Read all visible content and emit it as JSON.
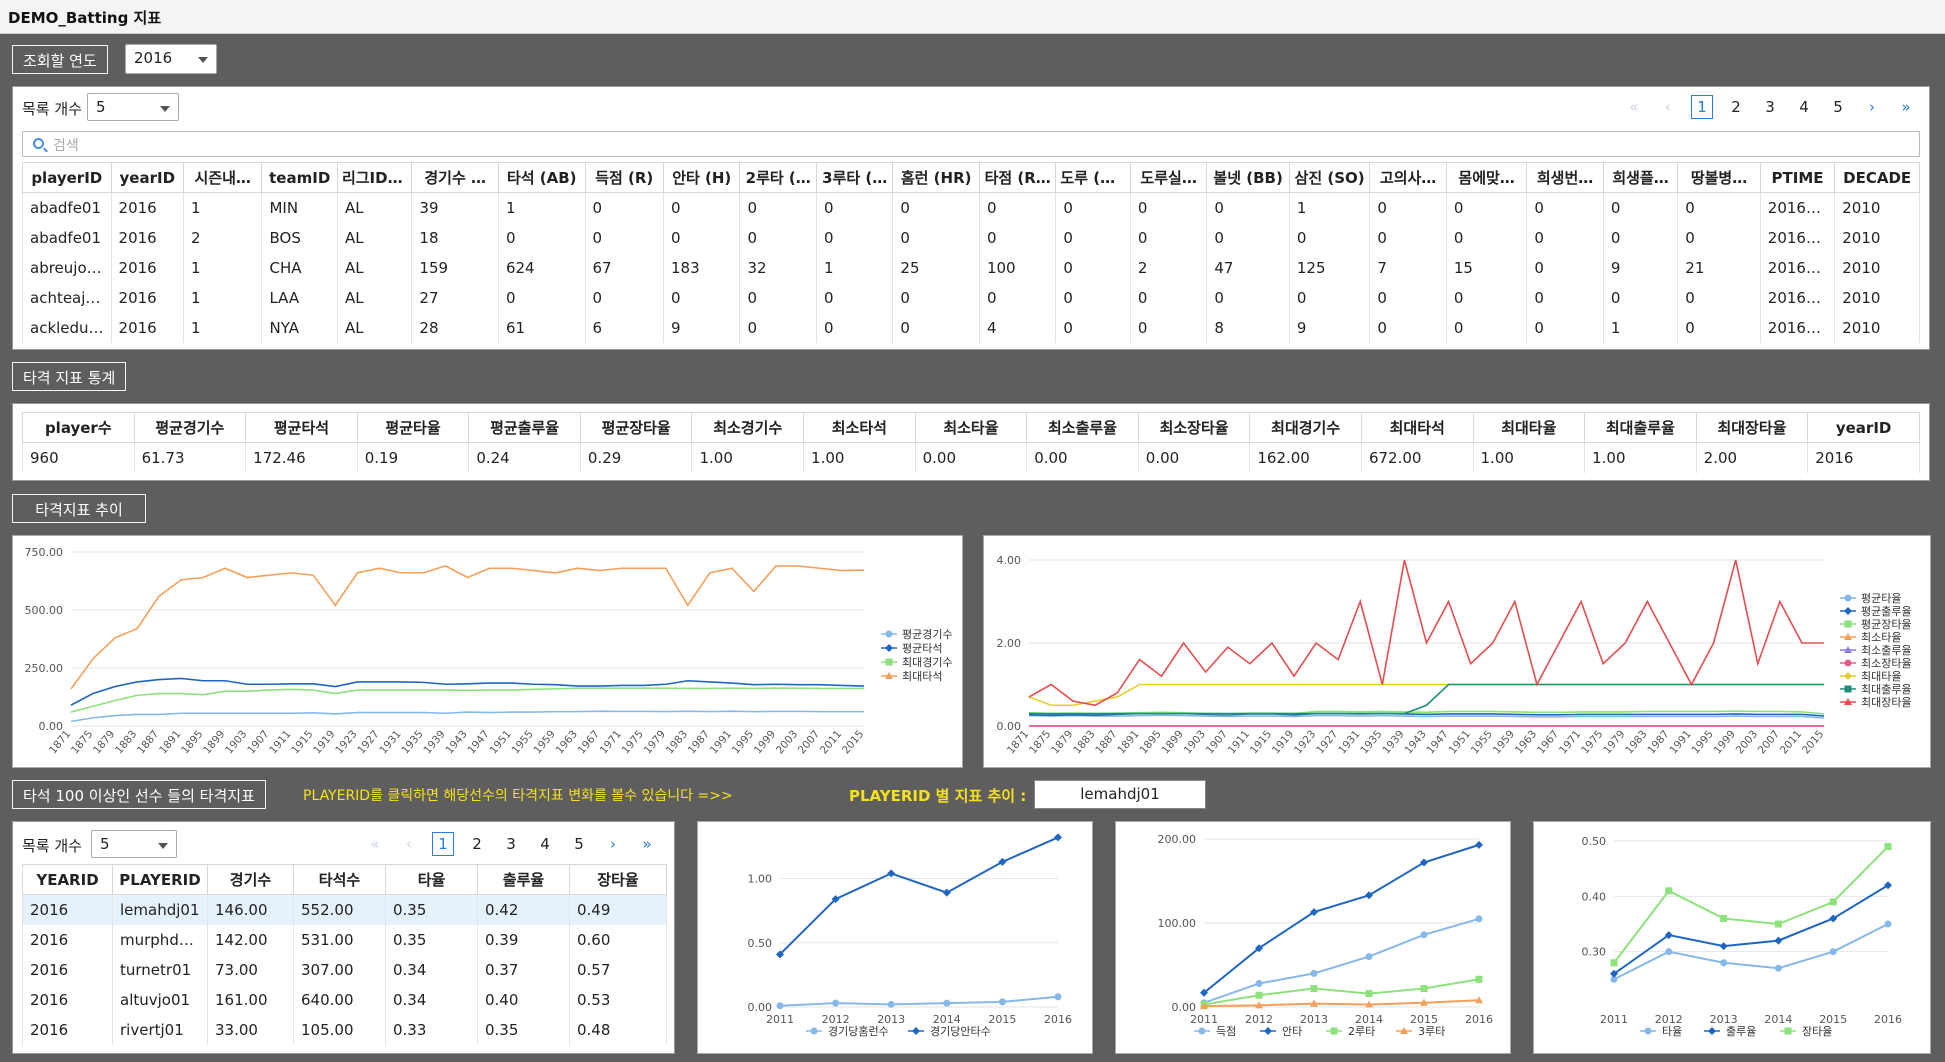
{
  "app": {
    "title": "DEMO_Batting 지표"
  },
  "year_filter": {
    "label": "조회할 연도",
    "value": "2016"
  },
  "top_table": {
    "count_label": "목록 개수",
    "count_value": "5",
    "search_placeholder": "검색",
    "pages": [
      "1",
      "2",
      "3",
      "4",
      "5"
    ],
    "current_page": "1",
    "columns": [
      "playerID",
      "yearID",
      "시즌내…",
      "teamID",
      "리그ID …",
      "경기수 …",
      "타석 (AB)",
      "득점 (R)",
      "안타 (H)",
      "2루타 (…",
      "3루타 (…",
      "홈런 (HR)",
      "타점 (R…",
      "도루 (SB)",
      "도루실…",
      "볼넷 (BB)",
      "삼진 (SO)",
      "고의사…",
      "몸에맞…",
      "희생번…",
      "희생플…",
      "땅볼병…",
      "PTIME",
      "DECADE"
    ],
    "rows": [
      [
        "abadfe01",
        "2016",
        "1",
        "MIN",
        "AL",
        "39",
        "1",
        "0",
        "0",
        "0",
        "0",
        "0",
        "0",
        "0",
        "0",
        "0",
        "1",
        "0",
        "0",
        "0",
        "0",
        "0",
        "20160…",
        "2010"
      ],
      [
        "abadfe01",
        "2016",
        "2",
        "BOS",
        "AL",
        "18",
        "0",
        "0",
        "0",
        "0",
        "0",
        "0",
        "0",
        "0",
        "0",
        "0",
        "0",
        "0",
        "0",
        "0",
        "0",
        "0",
        "20160…",
        "2010"
      ],
      [
        "abreujo02",
        "2016",
        "1",
        "CHA",
        "AL",
        "159",
        "624",
        "67",
        "183",
        "32",
        "1",
        "25",
        "100",
        "0",
        "2",
        "47",
        "125",
        "7",
        "15",
        "0",
        "9",
        "21",
        "20160…",
        "2010"
      ],
      [
        "achteaj01",
        "2016",
        "1",
        "LAA",
        "AL",
        "27",
        "0",
        "0",
        "0",
        "0",
        "0",
        "0",
        "0",
        "0",
        "0",
        "0",
        "0",
        "0",
        "0",
        "0",
        "0",
        "0",
        "20160…",
        "2010"
      ],
      [
        "ackledu…",
        "2016",
        "1",
        "NYA",
        "AL",
        "28",
        "61",
        "6",
        "9",
        "0",
        "0",
        "0",
        "4",
        "0",
        "0",
        "8",
        "9",
        "0",
        "0",
        "0",
        "1",
        "0",
        "20160…",
        "2010"
      ]
    ]
  },
  "stats_section": {
    "label": "타격 지표 통계",
    "columns": [
      "player수",
      "평균경기수",
      "평균타석",
      "평균타율",
      "평균출루율",
      "평균장타율",
      "최소경기수",
      "최소타석",
      "최소타율",
      "최소출루율",
      "최소장타율",
      "최대경기수",
      "최대타석",
      "최대타율",
      "최대출루율",
      "최대장타율",
      "yearID"
    ],
    "row": [
      "960",
      "61.73",
      "172.46",
      "0.19",
      "0.24",
      "0.29",
      "1.00",
      "1.00",
      "0.00",
      "0.00",
      "0.00",
      "162.00",
      "672.00",
      "1.00",
      "1.00",
      "2.00",
      "2016"
    ]
  },
  "trend_section": {
    "label": "타격지표 추이"
  },
  "colors": {
    "orange": "#f5a05a",
    "blue": "#1f66c4",
    "lightblue": "#86b8ea",
    "green": "#8de27c",
    "red": "#e64d4d",
    "yellow": "#e6cf2c",
    "teal": "#1f8f7a",
    "pink": "#e85a8c",
    "purple": "#8a7ee6"
  },
  "chart_data": [
    {
      "type": "line",
      "x_ticks": [
        "1871",
        "1875",
        "1879",
        "1883",
        "1887",
        "1891",
        "1895",
        "1899",
        "1903",
        "1907",
        "1911",
        "1915",
        "1919",
        "1923",
        "1927",
        "1931",
        "1935",
        "1939",
        "1943",
        "1947",
        "1951",
        "1955",
        "1959",
        "1963",
        "1967",
        "1971",
        "1975",
        "1979",
        "1983",
        "1987",
        "1991",
        "1995",
        "1999",
        "2003",
        "2007",
        "2011",
        "2015"
      ],
      "y_ticks": [
        "0.00",
        "250.00",
        "500.00",
        "750.00"
      ],
      "ylim": [
        0,
        750
      ],
      "series": [
        {
          "name": "평균경기수",
          "color": "#86b8ea",
          "values": [
            20,
            35,
            45,
            50,
            50,
            55,
            55,
            55,
            55,
            55,
            55,
            57,
            52,
            58,
            58,
            58,
            58,
            55,
            60,
            58,
            60,
            60,
            62,
            62,
            64,
            63,
            63,
            62,
            64,
            62,
            64,
            62,
            63,
            63,
            62,
            62,
            62
          ]
        },
        {
          "name": "평균타석",
          "color": "#1f66c4",
          "values": [
            90,
            140,
            170,
            190,
            200,
            205,
            195,
            195,
            180,
            180,
            182,
            182,
            170,
            190,
            190,
            190,
            188,
            180,
            182,
            185,
            185,
            180,
            178,
            172,
            172,
            175,
            175,
            180,
            195,
            190,
            185,
            178,
            180,
            178,
            178,
            175,
            172
          ]
        },
        {
          "name": "최대경기수",
          "color": "#8de27c",
          "values": [
            60,
            85,
            110,
            132,
            140,
            140,
            135,
            150,
            150,
            155,
            158,
            155,
            140,
            155,
            155,
            155,
            155,
            155,
            154,
            155,
            155,
            158,
            160,
            163,
            163,
            163,
            163,
            163,
            162,
            162,
            163,
            162,
            163,
            163,
            162,
            162,
            162
          ]
        },
        {
          "name": "최대타석",
          "color": "#f5a05a",
          "values": [
            160,
            290,
            380,
            420,
            560,
            630,
            640,
            680,
            640,
            650,
            660,
            650,
            520,
            660,
            680,
            660,
            660,
            690,
            640,
            680,
            680,
            670,
            660,
            680,
            670,
            680,
            680,
            680,
            520,
            660,
            680,
            580,
            690,
            690,
            680,
            670,
            672
          ]
        }
      ]
    },
    {
      "type": "line",
      "x_ticks": [
        "1871",
        "1875",
        "1879",
        "1883",
        "1887",
        "1891",
        "1895",
        "1899",
        "1903",
        "1907",
        "1911",
        "1915",
        "1919",
        "1923",
        "1927",
        "1931",
        "1935",
        "1939",
        "1943",
        "1947",
        "1951",
        "1955",
        "1959",
        "1963",
        "1967",
        "1971",
        "1975",
        "1979",
        "1983",
        "1987",
        "1991",
        "1995",
        "1999",
        "2003",
        "2007",
        "2011",
        "2015"
      ],
      "y_ticks": [
        "0.00",
        "2.00",
        "4.00"
      ],
      "ylim": [
        0,
        4
      ],
      "series": [
        {
          "name": "평균타율",
          "color": "#86b8ea",
          "values": [
            0.25,
            0.24,
            0.25,
            0.24,
            0.24,
            0.25,
            0.26,
            0.25,
            0.24,
            0.23,
            0.24,
            0.24,
            0.23,
            0.25,
            0.25,
            0.24,
            0.25,
            0.24,
            0.23,
            0.24,
            0.24,
            0.24,
            0.23,
            0.22,
            0.22,
            0.23,
            0.23,
            0.23,
            0.23,
            0.23,
            0.23,
            0.23,
            0.24,
            0.23,
            0.23,
            0.23,
            0.19
          ]
        },
        {
          "name": "평균출루율",
          "color": "#1f66c4",
          "values": [
            0.27,
            0.26,
            0.27,
            0.26,
            0.28,
            0.3,
            0.31,
            0.3,
            0.28,
            0.27,
            0.29,
            0.29,
            0.27,
            0.3,
            0.3,
            0.29,
            0.3,
            0.29,
            0.28,
            0.29,
            0.29,
            0.29,
            0.28,
            0.27,
            0.27,
            0.28,
            0.28,
            0.28,
            0.28,
            0.28,
            0.28,
            0.28,
            0.29,
            0.28,
            0.28,
            0.28,
            0.24
          ]
        },
        {
          "name": "평균장타율",
          "color": "#8de27c",
          "values": [
            0.32,
            0.3,
            0.31,
            0.3,
            0.31,
            0.32,
            0.33,
            0.32,
            0.3,
            0.29,
            0.31,
            0.31,
            0.3,
            0.35,
            0.35,
            0.34,
            0.35,
            0.34,
            0.33,
            0.35,
            0.35,
            0.35,
            0.34,
            0.33,
            0.33,
            0.34,
            0.34,
            0.34,
            0.35,
            0.35,
            0.35,
            0.35,
            0.36,
            0.35,
            0.35,
            0.34,
            0.29
          ]
        },
        {
          "name": "최소타율",
          "color": "#f5a05a",
          "values": [
            0,
            0,
            0,
            0,
            0,
            0,
            0,
            0,
            0,
            0,
            0,
            0,
            0,
            0,
            0,
            0,
            0,
            0,
            0,
            0,
            0,
            0,
            0,
            0,
            0,
            0,
            0,
            0,
            0,
            0,
            0,
            0,
            0,
            0,
            0,
            0,
            0
          ]
        },
        {
          "name": "최소출루율",
          "color": "#8a7ee6",
          "values": [
            0,
            0,
            0,
            0,
            0,
            0,
            0,
            0,
            0,
            0,
            0,
            0,
            0,
            0,
            0,
            0,
            0,
            0,
            0,
            0,
            0,
            0,
            0,
            0,
            0,
            0,
            0,
            0,
            0,
            0,
            0,
            0,
            0,
            0,
            0,
            0,
            0
          ]
        },
        {
          "name": "최소장타율",
          "color": "#e85a8c",
          "values": [
            0,
            0,
            0,
            0,
            0,
            0,
            0,
            0,
            0,
            0,
            0,
            0,
            0,
            0,
            0,
            0,
            0,
            0,
            0,
            0,
            0,
            0,
            0,
            0,
            0,
            0,
            0,
            0,
            0,
            0,
            0,
            0,
            0,
            0,
            0,
            0,
            0
          ]
        },
        {
          "name": "최대타율",
          "color": "#e6cf2c",
          "values": [
            0.7,
            0.5,
            0.5,
            0.6,
            0.7,
            1,
            1,
            1,
            1,
            1,
            1,
            1,
            1,
            1,
            1,
            1,
            1,
            1,
            1,
            1,
            1,
            1,
            1,
            1,
            1,
            1,
            1,
            1,
            1,
            1,
            1,
            1,
            1,
            1,
            1,
            1,
            1
          ]
        },
        {
          "name": "최대출루율",
          "color": "#1f8f7a",
          "values": [
            0.3,
            0.3,
            0.3,
            0.3,
            0.3,
            0.3,
            0.3,
            0.3,
            0.3,
            0.3,
            0.3,
            0.3,
            0.3,
            0.3,
            0.3,
            0.3,
            0.3,
            0.3,
            0.5,
            1,
            1,
            1,
            1,
            1,
            1,
            1,
            1,
            1,
            1,
            1,
            1,
            1,
            1,
            1,
            1,
            1,
            1
          ]
        },
        {
          "name": "최대장타율",
          "color": "#e64d4d",
          "values": [
            0.7,
            1,
            0.6,
            0.5,
            0.8,
            1.6,
            1.2,
            2,
            1.3,
            1.9,
            1.5,
            2,
            1.2,
            2,
            1.6,
            3,
            1,
            4,
            2,
            3,
            1.5,
            2,
            3,
            1,
            2,
            3,
            1.5,
            2,
            3,
            2,
            1,
            2,
            4,
            1.5,
            3,
            2,
            2
          ]
        }
      ]
    },
    {
      "type": "line",
      "x_ticks": [
        "2011",
        "2012",
        "2013",
        "2014",
        "2015",
        "2016"
      ],
      "y_ticks": [
        "0.00",
        "0.50",
        "1.00"
      ],
      "ylim": [
        0,
        1.3
      ],
      "series": [
        {
          "name": "경기당홈런수",
          "color": "#86b8ea",
          "values": [
            0.01,
            0.03,
            0.02,
            0.03,
            0.04,
            0.08
          ]
        },
        {
          "name": "경기당안타수",
          "color": "#1f66c4",
          "values": [
            0.41,
            0.84,
            1.04,
            0.89,
            1.13,
            1.32
          ]
        }
      ]
    },
    {
      "type": "line",
      "x_ticks": [
        "2011",
        "2012",
        "2013",
        "2014",
        "2015",
        "2016"
      ],
      "y_ticks": [
        "0.00",
        "100.00",
        "200.00"
      ],
      "ylim": [
        0,
        200
      ],
      "series": [
        {
          "name": "득점",
          "color": "#86b8ea",
          "values": [
            5,
            28,
            40,
            60,
            86,
            105
          ]
        },
        {
          "name": "안타",
          "color": "#1f66c4",
          "values": [
            17,
            70,
            113,
            133,
            172,
            193
          ]
        },
        {
          "name": "2루타",
          "color": "#8de27c",
          "values": [
            3,
            14,
            22,
            16,
            22,
            33
          ]
        },
        {
          "name": "3루타",
          "color": "#f5a05a",
          "values": [
            1,
            2,
            4,
            3,
            5,
            8
          ]
        }
      ]
    },
    {
      "type": "line",
      "x_ticks": [
        "2011",
        "2012",
        "2013",
        "2014",
        "2015",
        "2016"
      ],
      "y_ticks": [
        "0.30",
        "0.40",
        "0.50"
      ],
      "ylim": [
        0.2,
        0.5
      ],
      "series": [
        {
          "name": "타율",
          "color": "#86b8ea",
          "values": [
            0.25,
            0.3,
            0.28,
            0.27,
            0.3,
            0.35
          ]
        },
        {
          "name": "출루율",
          "color": "#1f66c4",
          "values": [
            0.26,
            0.33,
            0.31,
            0.32,
            0.36,
            0.42
          ]
        },
        {
          "name": "장타율",
          "color": "#8de27c",
          "values": [
            0.28,
            0.41,
            0.36,
            0.35,
            0.39,
            0.49
          ]
        }
      ]
    }
  ],
  "bottom_section": {
    "label": "타석 100 이상인  선수 들의 타격지표",
    "hint": "PLAYERID를 클릭하면 해당선수의 타격지표 변화를 볼수 있습니다 =>>",
    "player_trend_label": "PLAYERID 별 지표 추이 :",
    "player_value": "lemahdj01",
    "count_label": "목록 개수",
    "count_value": "5",
    "pages": [
      "1",
      "2",
      "3",
      "4",
      "5"
    ],
    "current_page": "1",
    "columns": [
      "YEARID",
      "PLAYERID",
      "경기수",
      "타석수",
      "타율",
      "출루율",
      "장타율"
    ],
    "rows": [
      [
        "2016",
        "lemahdj01",
        "146.00",
        "552.00",
        "0.35",
        "0.42",
        "0.49"
      ],
      [
        "2016",
        "murphd…",
        "142.00",
        "531.00",
        "0.35",
        "0.39",
        "0.60"
      ],
      [
        "2016",
        "turnetr01",
        "73.00",
        "307.00",
        "0.34",
        "0.37",
        "0.57"
      ],
      [
        "2016",
        "altuvjo01",
        "161.00",
        "640.00",
        "0.34",
        "0.40",
        "0.53"
      ],
      [
        "2016",
        "rivertj01",
        "33.00",
        "105.00",
        "0.33",
        "0.35",
        "0.48"
      ]
    ]
  }
}
